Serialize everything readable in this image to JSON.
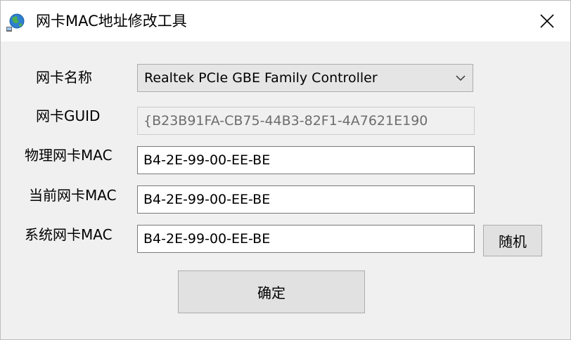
{
  "window": {
    "title": "网卡MAC地址修改工具",
    "app_icon": "network-globe-icon",
    "close_icon": "close-icon"
  },
  "form": {
    "adapter_name_label": "网卡名称",
    "adapter_name_value": "Realtek PCIe GBE Family Controller",
    "guid_label": "网卡GUID",
    "guid_value": "{B23B91FA-CB75-44B3-82F1-4A7621E190",
    "physical_mac_label": "物理网卡MAC",
    "physical_mac_value": "B4-2E-99-00-EE-BE",
    "current_mac_label": "当前网卡MAC",
    "current_mac_value": "B4-2E-99-00-EE-BE",
    "system_mac_label": "系统网卡MAC",
    "system_mac_value": "B4-2E-99-00-EE-BE",
    "random_button": "随机",
    "ok_button": "确定"
  }
}
